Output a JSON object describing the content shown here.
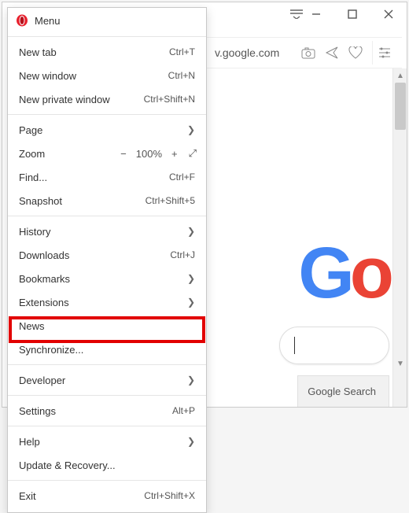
{
  "window": {
    "tab_overflow_icon": "tab-overflow",
    "min": "—",
    "max": "☐",
    "close": "✕"
  },
  "address": {
    "url_fragment": "v.google.com"
  },
  "menu": {
    "title": "Menu",
    "items1": [
      {
        "label": "New tab",
        "accel": "Ctrl+T"
      },
      {
        "label": "New window",
        "accel": "Ctrl+N"
      },
      {
        "label": "New private window",
        "accel": "Ctrl+Shift+N"
      }
    ],
    "page": {
      "label": "Page"
    },
    "zoom": {
      "label": "Zoom",
      "minus": "−",
      "value": "100%",
      "plus": "+",
      "full": "⤢"
    },
    "find": {
      "label": "Find...",
      "accel": "Ctrl+F"
    },
    "snapshot": {
      "label": "Snapshot",
      "accel": "Ctrl+Shift+5"
    },
    "history": {
      "label": "History"
    },
    "downloads": {
      "label": "Downloads",
      "accel": "Ctrl+J"
    },
    "bookmarks": {
      "label": "Bookmarks"
    },
    "extensions": {
      "label": "Extensions"
    },
    "news": {
      "label": "News"
    },
    "sync": {
      "label": "Synchronize..."
    },
    "developer": {
      "label": "Developer"
    },
    "settings": {
      "label": "Settings",
      "accel": "Alt+P"
    },
    "help": {
      "label": "Help"
    },
    "update": {
      "label": "Update & Recovery..."
    },
    "exit": {
      "label": "Exit",
      "accel": "Ctrl+Shift+X"
    }
  },
  "content": {
    "search_button": "Google Search"
  }
}
